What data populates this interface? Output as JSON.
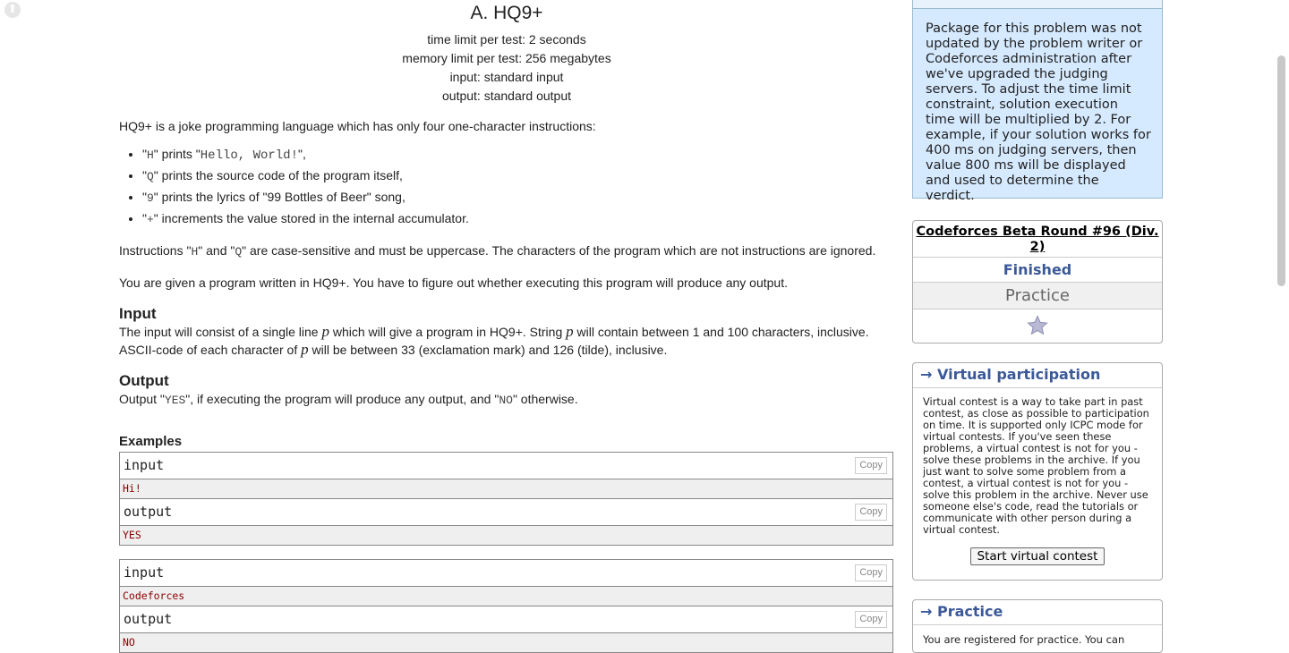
{
  "problem": {
    "title": "A. HQ9+",
    "time_limit": "time limit per test: 2 seconds",
    "memory_limit": "memory limit per test: 256 megabytes",
    "input_src": "input: standard input",
    "output_src": "output: standard output",
    "intro": "HQ9+ is a joke programming language which has only four one-character instructions:",
    "instructions": [
      {
        "q1": "\"",
        "code": "H",
        "q2": "\"",
        "mid": " prints \"",
        "code2": "Hello, World!",
        "rest": "\","
      },
      {
        "q1": "\"",
        "code": "Q",
        "q2": "\"",
        "rest": " prints the source code of the program itself,"
      },
      {
        "q1": "\"",
        "code": "9",
        "q2": "\"",
        "rest": " prints the lyrics of \"99 Bottles of Beer\" song,"
      },
      {
        "q1": "\"",
        "code": "+",
        "q2": "\"",
        "rest": " increments the value stored in the internal accumulator."
      }
    ],
    "case_a": "Instructions \"",
    "case_h": "H",
    "case_b": "\" and \"",
    "case_q": "Q",
    "case_c": "\" are case-sensitive and must be uppercase. The characters of the program which are not instructions are ignored.",
    "given": "You are given a program written in HQ9+. You have to figure out whether executing this program will produce any output.",
    "input_title": "Input",
    "input_a": "The input will consist of a single line ",
    "var_p": "p",
    "input_b": " which will give a program in HQ9+. String ",
    "input_c": " will contain between 1 and 100 characters, inclusive.",
    "input_d": "ASCII-code of each character of ",
    "input_e": " will be between 33 (exclamation mark) and 126 (tilde), inclusive.",
    "output_title": "Output",
    "output_a": "Output \"",
    "output_yes": "YES",
    "output_b": "\", if executing the program will produce any output, and \"",
    "output_no": "NO",
    "output_c": "\" otherwise.",
    "examples_title": "Examples",
    "examples": [
      {
        "input_label": "input",
        "input": "Hi!",
        "output_label": "output",
        "output": "YES"
      },
      {
        "input_label": "input",
        "input": "Codeforces",
        "output_label": "output",
        "output": "NO"
      }
    ],
    "copy_label": "Copy"
  },
  "sidebar": {
    "attention_text": "Package for this problem was not updated by the problem writer or Codeforces administration after we've upgraded the judging servers. To adjust the time limit constraint, solution execution time will be multiplied by 2. For example, if your solution works for 400 ms on judging servers, then value 800 ms will be displayed and used to determine the verdict.",
    "contest_name": "Codeforces Beta Round #96 (Div. 2)",
    "contest_status": "Finished",
    "contest_mode": "Practice",
    "virtual_title": "→ Virtual participation",
    "virtual_text": "Virtual contest is a way to take part in past contest, as close as possible to participation on time. It is supported only ICPC mode for virtual contests. If you've seen these problems, a virtual contest is not for you - solve these problems in the archive. If you just want to solve some problem from a contest, a virtual contest is not for you - solve this problem in the archive. Never use someone else's code, read the tutorials or communicate with other person during a virtual contest.",
    "virtual_button": "Start virtual contest",
    "practice_title": "→ Practice",
    "practice_text": "You are registered for practice. You can"
  },
  "colors": {
    "accent": "#3b5998",
    "attention_bg": "#d6eaff",
    "example_text": "#8b0000"
  }
}
